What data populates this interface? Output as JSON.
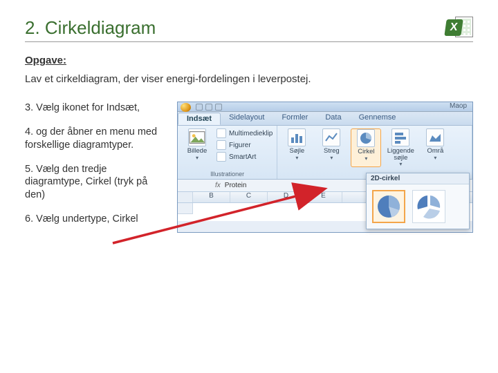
{
  "title": "2. Cirkeldiagram",
  "subheading": "Opgave:",
  "task": "Lav et cirkeldiagram, der viser energi-fordelingen i leverpostej.",
  "logo_letter": "X",
  "steps": {
    "s3": "3. Vælg ikonet for Indsæt,",
    "s4": "4. og der åbner en menu med forskellige diagramtyper.",
    "s5": "5. Vælg den tredje diagramtype, Cirkel (tryk på den)",
    "s6": "6. Vælg undertype, Cirkel"
  },
  "ribbon": {
    "app_title": "Maop",
    "tabs": [
      "Indsæt",
      "Sidelayout",
      "Formler",
      "Data",
      "Gennemse"
    ],
    "active_tab": "Indsæt",
    "group_illustrations": {
      "label": "Illustrationer",
      "big": {
        "label": "Billede"
      },
      "items": [
        "Multimedieklip",
        "Figurer",
        "SmartArt"
      ]
    },
    "group_charts": {
      "label": "",
      "items": [
        {
          "label": "Søjle"
        },
        {
          "label": "Streg"
        },
        {
          "label": "Cirkel"
        },
        {
          "label": "Liggende søjle"
        },
        {
          "label": "Områ"
        }
      ]
    },
    "gallery": {
      "header": "2D-cirkel"
    },
    "formula_bar": {
      "fx": "fx",
      "value": "Protein"
    },
    "columns": [
      "B",
      "C",
      "D",
      "E"
    ]
  }
}
